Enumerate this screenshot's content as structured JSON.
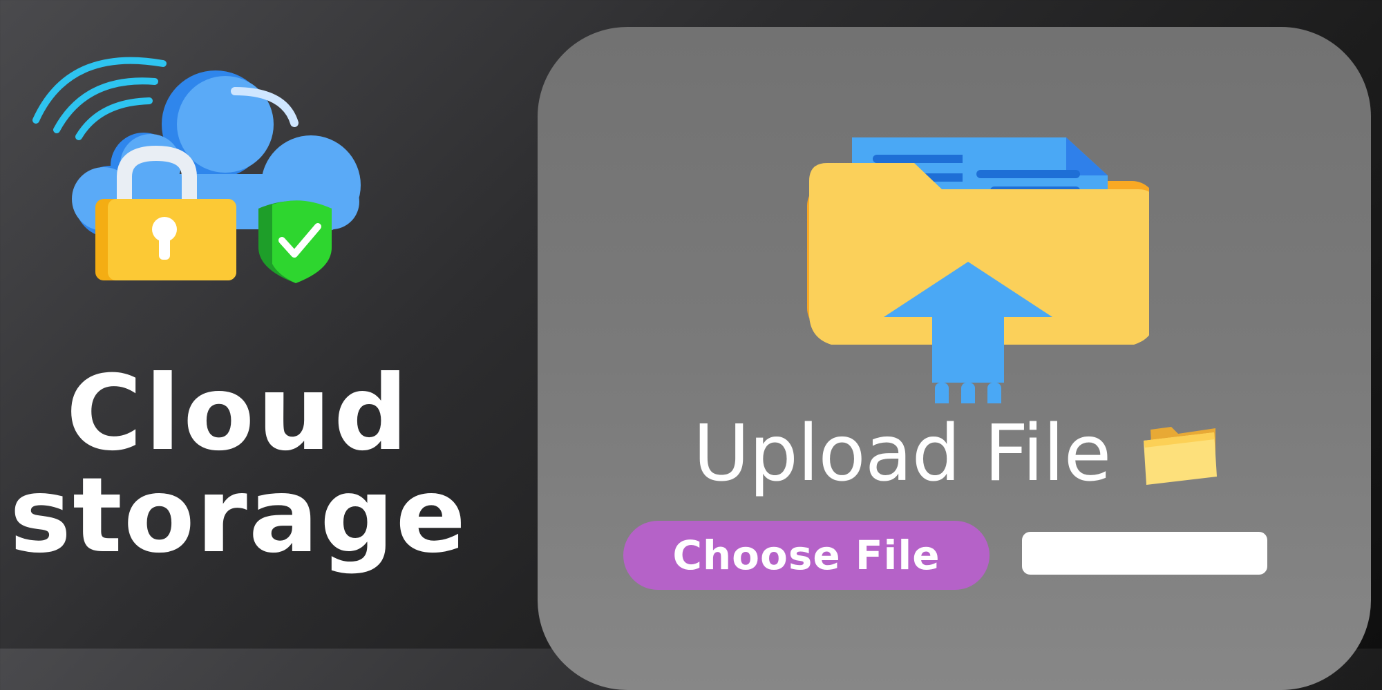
{
  "brand": {
    "title_line1": "Cloud",
    "title_line2": "storage",
    "illustration_icons": [
      "wifi-signal-icon",
      "cloud-icon",
      "padlock-icon",
      "security-shield-check-icon"
    ]
  },
  "upload": {
    "heading": "Upload File",
    "heading_icon": "folder-emoji-icon",
    "main_icon": "folder-upload-arrow-icon",
    "choose_button_label": "Choose File",
    "file_name_value": "",
    "file_name_placeholder": ""
  },
  "colors": {
    "card_background": "#777777",
    "choose_button": "#b562c8",
    "cloud_blue": "#5aaaf7",
    "lock_yellow": "#f7c236",
    "shield_green": "#2dc831",
    "folder_yellow": "#fbd05a",
    "arrow_blue": "#4aa8f5",
    "text_white": "#ffffff"
  }
}
